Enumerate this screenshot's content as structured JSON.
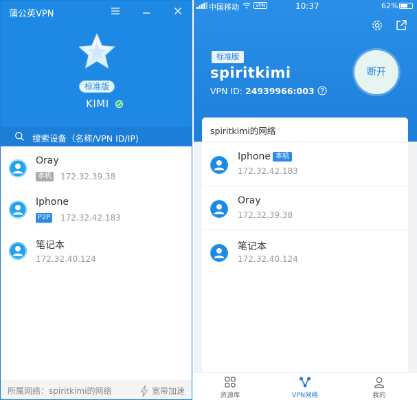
{
  "desktop": {
    "title": "蒲公英VPN",
    "edition": "标准版",
    "username": "KIMI",
    "search_placeholder": "搜索设备（名称/VPN ID/IP)",
    "devices": [
      {
        "name": "Oray",
        "tag": "本机",
        "ip": "172.32.39.38"
      },
      {
        "name": "Iphone",
        "tag": "P2P",
        "ip": "172.32.42.183"
      },
      {
        "name": "笔记本",
        "tag": "",
        "ip": "172.32.40.124"
      }
    ],
    "footer_network": "所属网络：spiritkimi的网络",
    "footer_speed": "宽带加速"
  },
  "mobile": {
    "status_bar": {
      "carrier": "中国移动",
      "vpn": "VPN",
      "time": "10:37",
      "battery": "62%",
      "battery_level": 0.62
    },
    "edition": "标准版",
    "username": "spiritkimi",
    "vpn_id_label": "VPN ID:",
    "vpn_id": "24939966:003",
    "disconnect": "断开",
    "network_title": "spiritkimi的网络",
    "devices": [
      {
        "name": "Iphone",
        "tag": "本机",
        "ip": "172.32.42.183"
      },
      {
        "name": "Oray",
        "tag": "",
        "ip": "172.32.39.38"
      },
      {
        "name": "笔记本",
        "tag": "",
        "ip": "172.32.40.124"
      }
    ],
    "tabs": [
      {
        "label": "资源库",
        "icon": "grid-icon"
      },
      {
        "label": "VPN网络",
        "icon": "network-icon"
      },
      {
        "label": "我的",
        "icon": "user-icon"
      }
    ]
  },
  "colors": {
    "brand_blue": "#1e88e5",
    "online_green": "#33cc55",
    "avatar_blue": "#1ea5ee"
  }
}
